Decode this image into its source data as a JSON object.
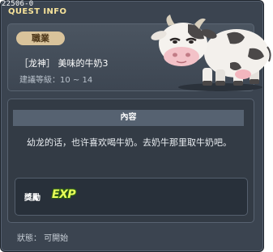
{
  "quest": {
    "id": "22506-0",
    "window_title": "QUEST INFO",
    "job_badge": "職業",
    "name": "［龙神］ 美味的牛奶3",
    "level_text": "建議等級：10 ~ 14",
    "section_title": "內容",
    "description": "幼龙的话，也许喜欢喝牛奶。去奶牛那里取牛奶吧。",
    "reward_label": "獎勵",
    "reward_item": "EXP",
    "status": "狀態： 可開始"
  },
  "icons": {
    "npc": "cow-npc-icon",
    "reward": "exp-icon"
  },
  "colors": {
    "title": "#f7e39a",
    "badge": "#d9c39b",
    "panel": "#3b4450",
    "exp": "#e9ff5a"
  }
}
